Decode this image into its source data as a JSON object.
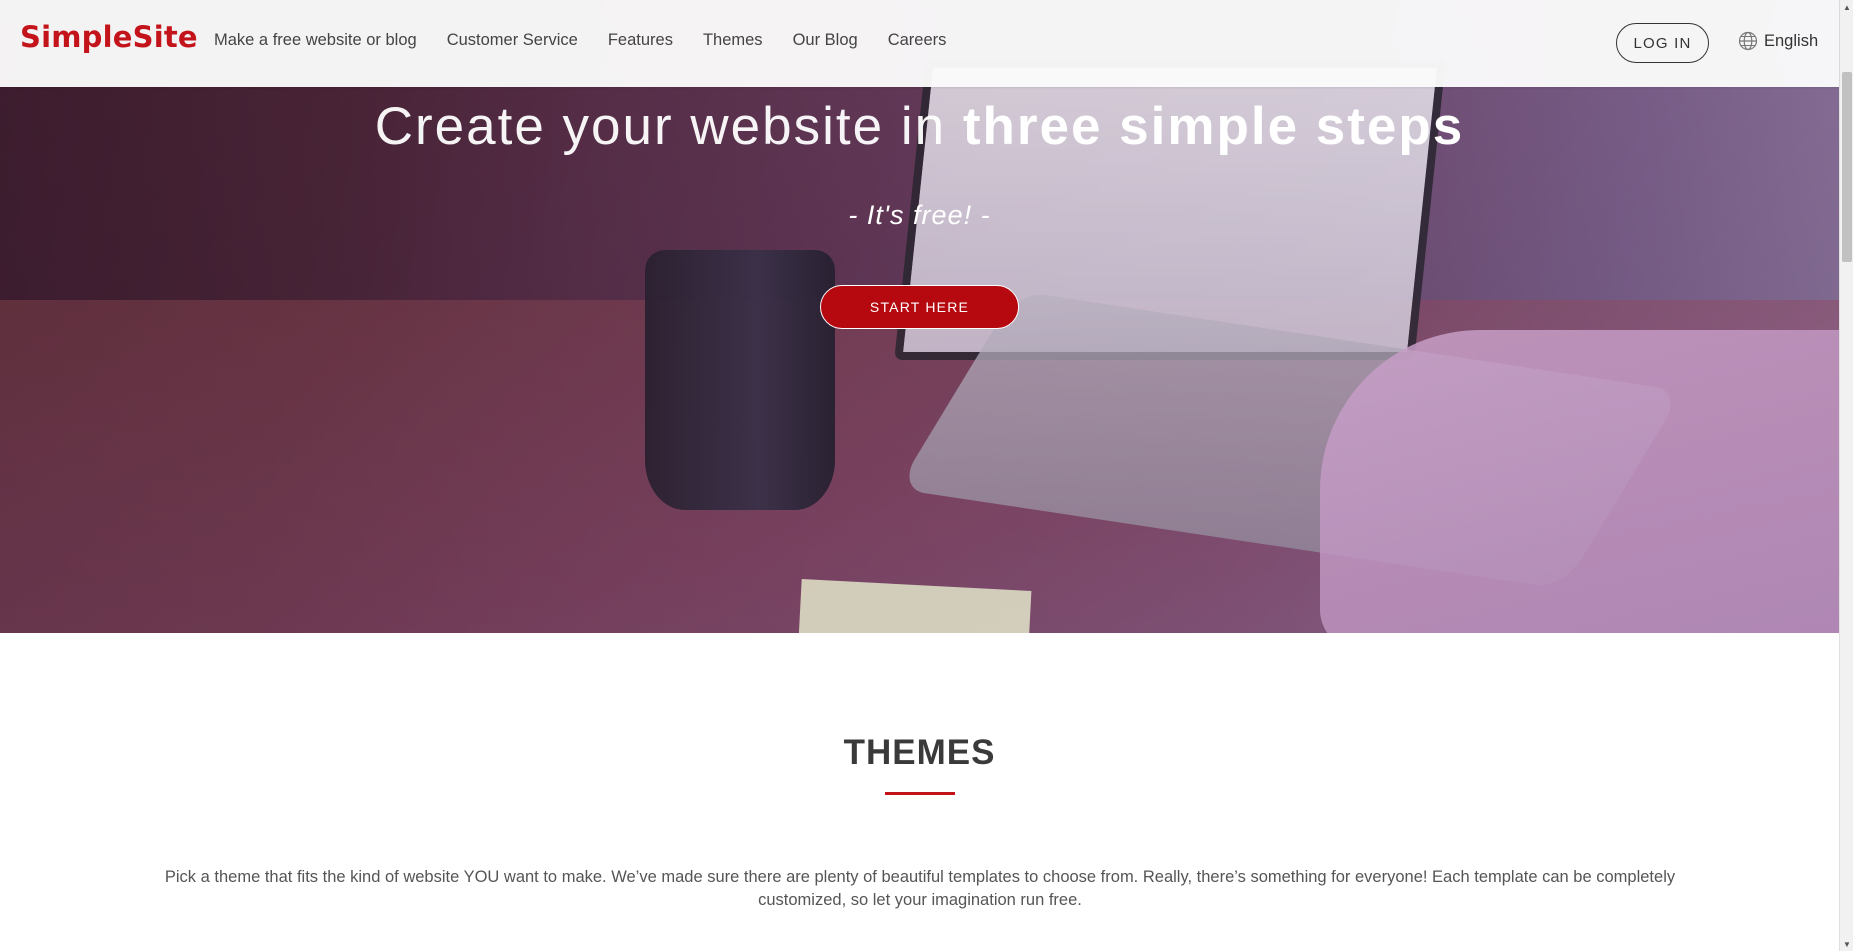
{
  "header": {
    "logo_text": "SimpleSite",
    "nav_items": [
      {
        "label": "Make a free website or blog"
      },
      {
        "label": "Customer Service"
      },
      {
        "label": "Features"
      },
      {
        "label": "Themes"
      },
      {
        "label": "Our Blog"
      },
      {
        "label": "Careers"
      }
    ],
    "login_label": "LOG IN",
    "language_label": "English",
    "language_icon": "globe-icon"
  },
  "hero": {
    "title_part1": "Create your website",
    "title_part2": "in",
    "title_part3": "three simple steps",
    "subtitle": "- It's free! -",
    "cta_label": "START HERE"
  },
  "themes": {
    "heading": "THEMES",
    "description": "Pick a theme that fits the kind of website YOU want to make. We’ve made sure there are plenty of beautiful templates to choose from. Really, there’s something for everyone! Each template can be completely customized, so let your imagination run free."
  },
  "colors": {
    "brand": "#c4141b",
    "cta_background": "#b5080f",
    "header_background": "#fafafa",
    "heading_text": "#3a3a3a"
  }
}
